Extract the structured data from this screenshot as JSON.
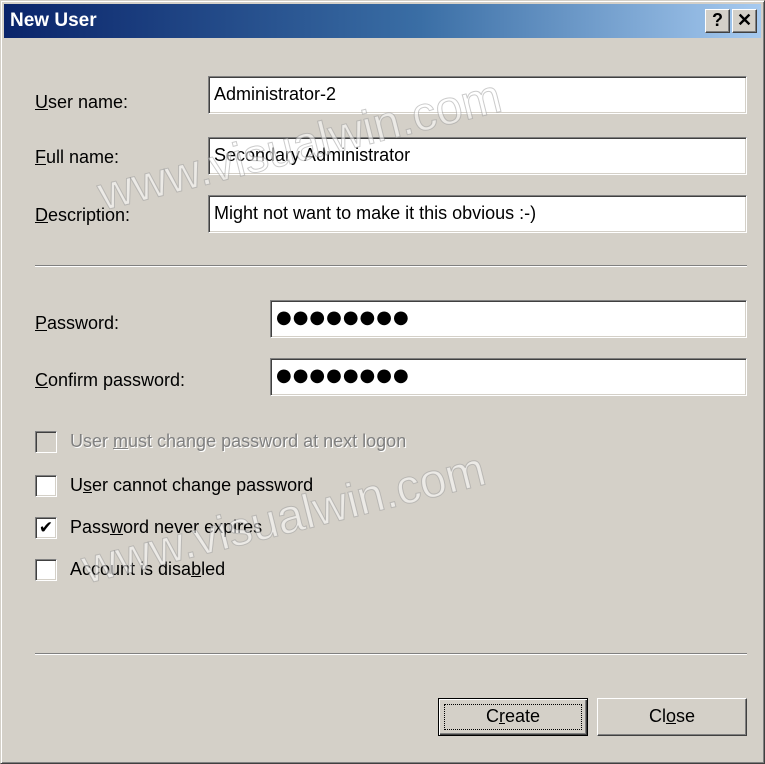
{
  "window": {
    "title": "New User",
    "help_button": "?",
    "close_button": "✕"
  },
  "user_section": {
    "username": {
      "label_pre": "",
      "label_ul": "U",
      "label_post": "ser name:",
      "value": "Administrator-2"
    },
    "fullname": {
      "label_pre": "",
      "label_ul": "F",
      "label_post": "ull name:",
      "value": "Secondary Administrator"
    },
    "description": {
      "label_pre": "",
      "label_ul": "D",
      "label_post": "escription:",
      "value": "Might not want to make it this obvious :-)"
    }
  },
  "password_section": {
    "password": {
      "label_pre": "",
      "label_ul": "P",
      "label_post": "assword:",
      "value": "●●●●●●●●"
    },
    "confirm": {
      "label_pre": "",
      "label_ul": "C",
      "label_post": "onfirm password:",
      "value": "●●●●●●●●"
    }
  },
  "options": [
    {
      "pre": "User ",
      "ul": "m",
      "post": "ust change password at next logon",
      "checked": false,
      "disabled": true
    },
    {
      "pre": "U",
      "ul": "s",
      "post": "er cannot change password",
      "checked": false,
      "disabled": false
    },
    {
      "pre": "Pass",
      "ul": "w",
      "post": "ord never expires",
      "checked": true,
      "disabled": false
    },
    {
      "pre": "Account is disa",
      "ul": "b",
      "post": "led",
      "checked": false,
      "disabled": false
    }
  ],
  "check_mark": "✔",
  "buttons": {
    "create": {
      "pre": "C",
      "ul": "r",
      "post": "eate"
    },
    "close": {
      "pre": "Cl",
      "ul": "o",
      "post": "se"
    }
  },
  "watermark": "www.visualwin.com"
}
